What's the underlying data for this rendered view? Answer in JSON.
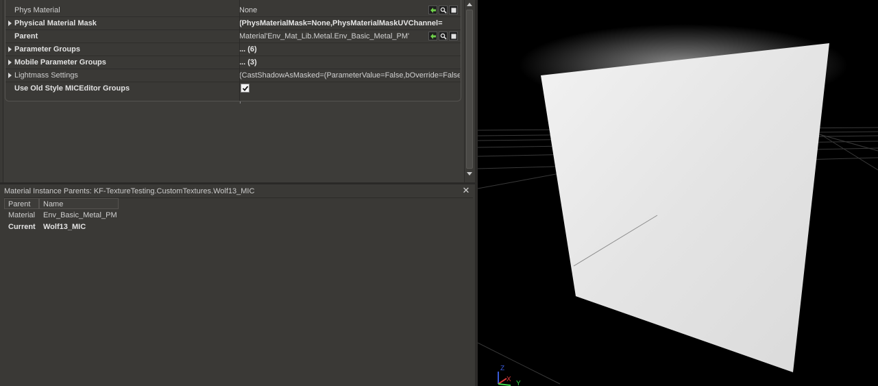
{
  "properties": {
    "rows": [
      {
        "id": "phys-material",
        "name": "Phys Material",
        "value": "None",
        "bold": false,
        "expandable": false
      },
      {
        "id": "physical-material-mask",
        "name": "Physical Material Mask",
        "value": "(PhysMaterialMask=None,PhysMaterialMaskUVChannel=",
        "bold": true,
        "expandable": true
      },
      {
        "id": "parent",
        "name": "Parent",
        "value": "Material'Env_Mat_Lib.Metal.Env_Basic_Metal_PM'",
        "bold": true,
        "expandable": false
      },
      {
        "id": "parameter-groups",
        "name": "Parameter Groups",
        "value": "... (6)",
        "bold": true,
        "expandable": true
      },
      {
        "id": "mobile-parameter-groups",
        "name": "Mobile Parameter Groups",
        "value": "... (3)",
        "bold": true,
        "expandable": true
      },
      {
        "id": "lightmass-settings",
        "name": "Lightmass Settings",
        "value": "(CastShadowAsMasked=(ParameterValue=False,bOverride=False)",
        "bold": false,
        "expandable": true
      },
      {
        "id": "use-old-style-miceditor-groups",
        "name": "Use Old Style MICEditor Groups",
        "value": "",
        "bold": true,
        "expandable": false,
        "checked": true
      }
    ]
  },
  "parents_panel": {
    "title": "Material Instance Parents: KF-TextureTesting.CustomTextures.Wolf13_MIC",
    "close_glyph": "✕",
    "columns": {
      "parent": "Parent",
      "name": "Name"
    },
    "rows": [
      {
        "parent": "Material",
        "name": "Env_Basic_Metal_PM",
        "bold": false
      },
      {
        "parent": "Current",
        "name": "Wolf13_MIC",
        "bold": true
      }
    ]
  },
  "viewport": {
    "axis_labels": {
      "z": "Z",
      "x": "X",
      "y": "Y"
    },
    "axis_colors": {
      "z": "#3a5bd9",
      "x": "#d93a3a",
      "y": "#3ad94a"
    }
  },
  "icons": {
    "use": "use-selected-arrow-icon",
    "browse": "browse-magnifier-icon",
    "clear": "clear-square-icon"
  }
}
